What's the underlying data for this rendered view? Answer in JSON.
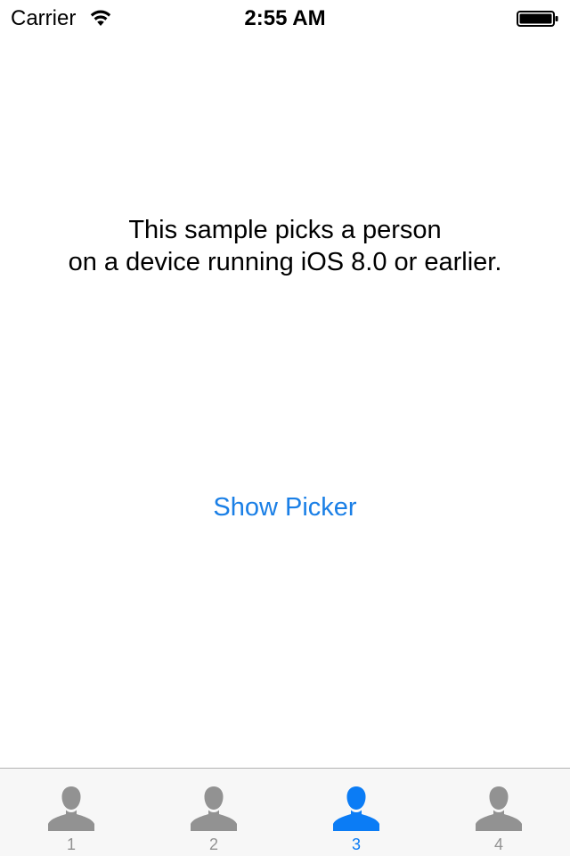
{
  "status_bar": {
    "carrier": "Carrier",
    "time": "2:55 AM",
    "wifi_icon": "wifi-icon",
    "battery_icon": "battery-full-icon"
  },
  "main": {
    "description_line1": "This sample picks a person",
    "description_line2": "on a device running iOS 8.0 or earlier.",
    "show_picker_label": "Show Picker"
  },
  "tab_bar": {
    "active_index": 2,
    "colors": {
      "active": "#0b7cf5",
      "inactive": "#929292"
    },
    "tabs": [
      {
        "label": "1",
        "icon": "person-icon"
      },
      {
        "label": "2",
        "icon": "person-icon"
      },
      {
        "label": "3",
        "icon": "person-icon"
      },
      {
        "label": "4",
        "icon": "person-icon"
      }
    ]
  }
}
